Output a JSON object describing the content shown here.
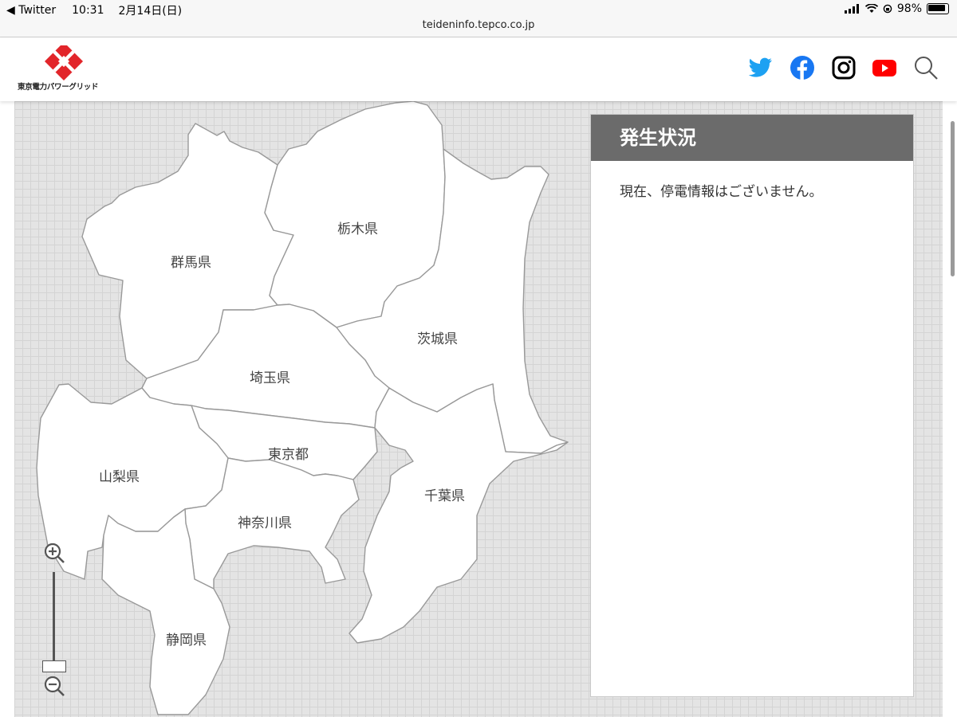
{
  "status_bar": {
    "back_app": "◀ Twitter",
    "time": "10:31",
    "date": "2月14日(日)",
    "battery": "98%"
  },
  "browser": {
    "url": "teideninfo.tepco.co.jp"
  },
  "header": {
    "logo_text": "東京電力パワーグリッド",
    "brand_color": "#e2252a",
    "social_icons": [
      "twitter-icon",
      "facebook-icon",
      "instagram-icon",
      "youtube-icon",
      "search-icon"
    ]
  },
  "map": {
    "prefectures": {
      "gunma": "群馬県",
      "tochigi": "栃木県",
      "ibaraki": "茨城県",
      "saitama": "埼玉県",
      "tokyo": "東京都",
      "yamanashi": "山梨県",
      "kanagawa": "神奈川県",
      "chiba": "千葉県",
      "shizuoka": "静岡県"
    }
  },
  "status_panel": {
    "title": "発生状況",
    "message": "現在、停電情報はございません。"
  }
}
